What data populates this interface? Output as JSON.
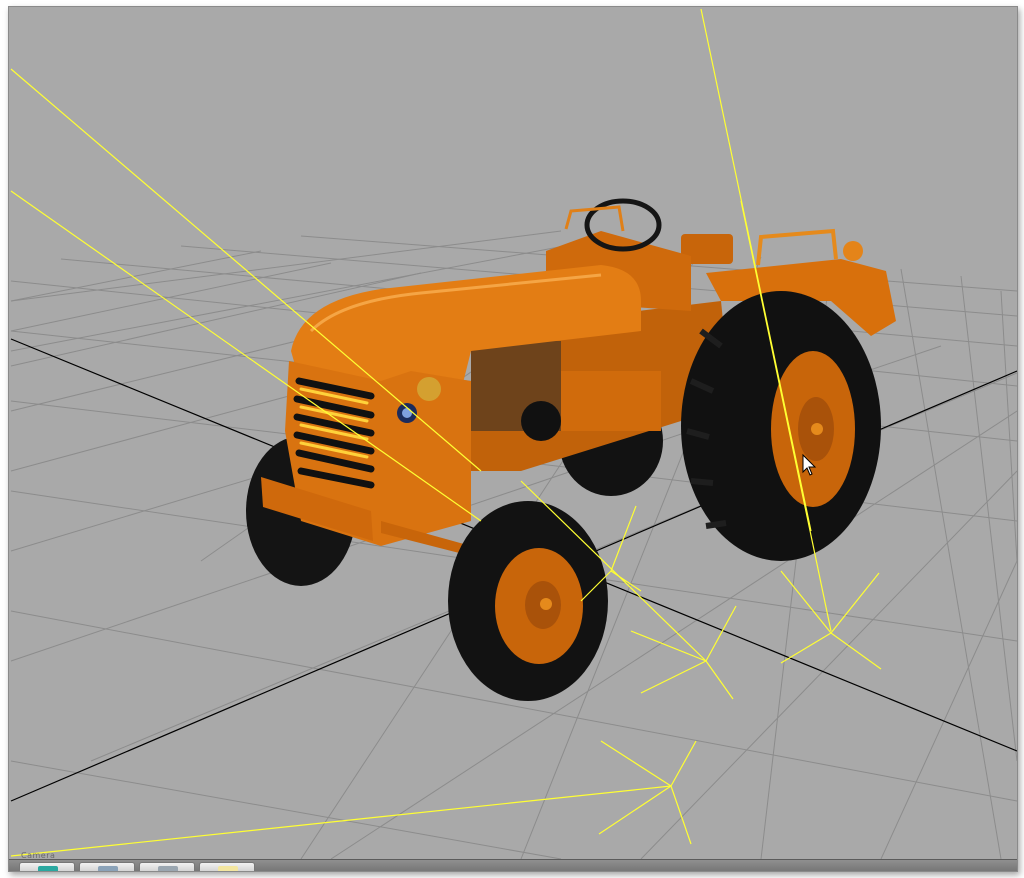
{
  "viewport": {
    "camera_label": "Camera",
    "background_color": "#a9a9a9",
    "grid_color": "#8c8c8c",
    "axis_color": "#000000",
    "guide_line_color": "#ffff33",
    "model_color": "#e07a10",
    "tire_color": "#121212",
    "object_name": "tractor-model"
  },
  "bottom_tabs": [
    {
      "icon": "viewport-tab-icon",
      "color": "#2aa8a0"
    },
    {
      "icon": "folder-tab-icon",
      "color": "#8aa2b8"
    },
    {
      "icon": "document-tab-icon",
      "color": "#9aa6b0"
    },
    {
      "icon": "note-tab-icon",
      "color": "#f3e6a0"
    }
  ]
}
